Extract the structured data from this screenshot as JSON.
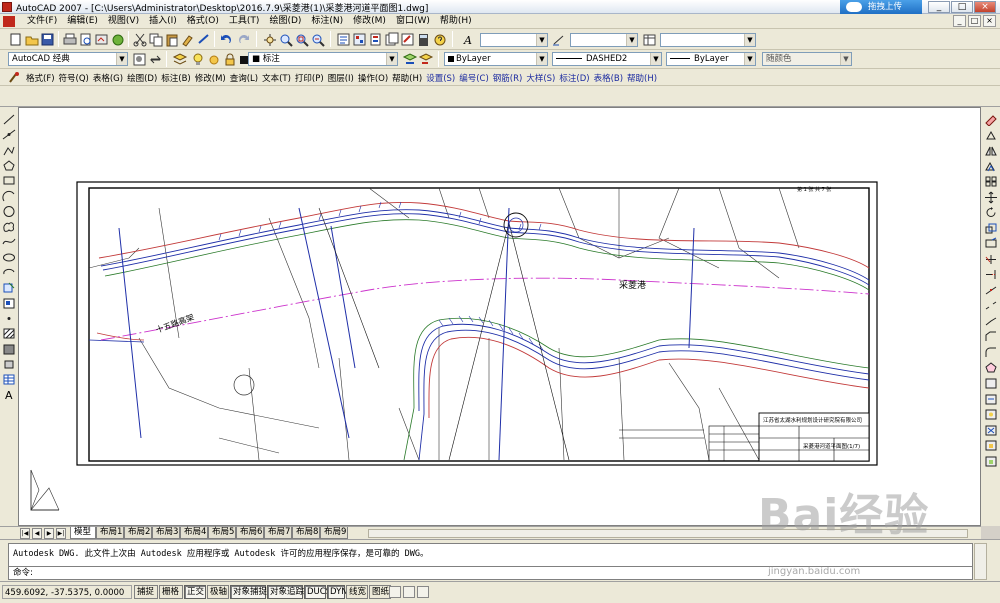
{
  "window": {
    "title": "AutoCAD 2007 - [C:\\Users\\Administrator\\Desktop\\2016.7.9\\采菱港(1)\\采菱港河道平面图1.dwg]",
    "upload_button": "拖拽上传",
    "controls": [
      "_",
      "□",
      "×"
    ]
  },
  "menubar": {
    "items": [
      "文件(F)",
      "编辑(E)",
      "视图(V)",
      "插入(I)",
      "格式(O)",
      "工具(T)",
      "绘图(D)",
      "标注(N)",
      "修改(M)",
      "窗口(W)",
      "帮助(H)"
    ],
    "doc_controls": [
      "_",
      "□",
      "×"
    ]
  },
  "toolbar2": {
    "workspace": "AutoCAD 经典",
    "layer": "■ 标注",
    "color": "ByLayer",
    "linetype": "DASHED2",
    "lineweight": "ByLayer",
    "plotstyle": "随颜色"
  },
  "toolbar3": {
    "items": [
      "格式(F)",
      "符号(Q)",
      "表格(G)",
      "绘图(D)",
      "标注(B)",
      "修改(M)",
      "查询(L)",
      "文本(T)",
      "打印(P)",
      "图层(I)",
      "操作(O)",
      "帮助(H)"
    ],
    "items_blue": [
      "设置(S)",
      "编号(C)",
      "钢筋(R)",
      "大样(S)",
      "标注(D)",
      "表格(B)",
      "帮助(H)"
    ]
  },
  "layout_tabs": {
    "tabs": [
      "模型",
      "布局1",
      "布局2",
      "布局3",
      "布局4",
      "布局5",
      "布局6",
      "布局7",
      "布局8",
      "布局9"
    ],
    "active_index": 0
  },
  "command": {
    "history": "Autodesk DWG.   此文件上次由 Autodesk 应用程序或 Autodesk 许可的应用程序保存，是可靠的 DWG。",
    "prompt": "命令:"
  },
  "statusbar": {
    "coords": "459.6092, -37.5375, 0.0000",
    "toggles": [
      "捕捉",
      "栅格",
      "正交",
      "极轴",
      "对象捕捉",
      "对象追踪",
      "DUCS",
      "DYN",
      "线宽",
      "图纸"
    ],
    "on_toggles": [
      "正交",
      "对象捕捉",
      "对象追踪",
      "DUCS",
      "DYN"
    ]
  },
  "drawing": {
    "title_block": {
      "company": "江苏省太湖水利规划设计研究院有限公司",
      "drawing_name": "采菱港河道平面图(1/7)",
      "sheet": "第 1 张 共 7 张"
    },
    "labels": {
      "river_name": "采菱港",
      "road_label": "十五路高架"
    }
  },
  "watermark": {
    "text": "Bai经验",
    "url": "jingyan.baidu.com"
  },
  "colors": {
    "bg": "#d4d0c8",
    "drawing_bg": "#ffffff",
    "river_line": "#c23a3a",
    "centerline": "#cc33cc",
    "bank_blue": "#1f2fa8",
    "bank_green": "#2a7a2a"
  }
}
